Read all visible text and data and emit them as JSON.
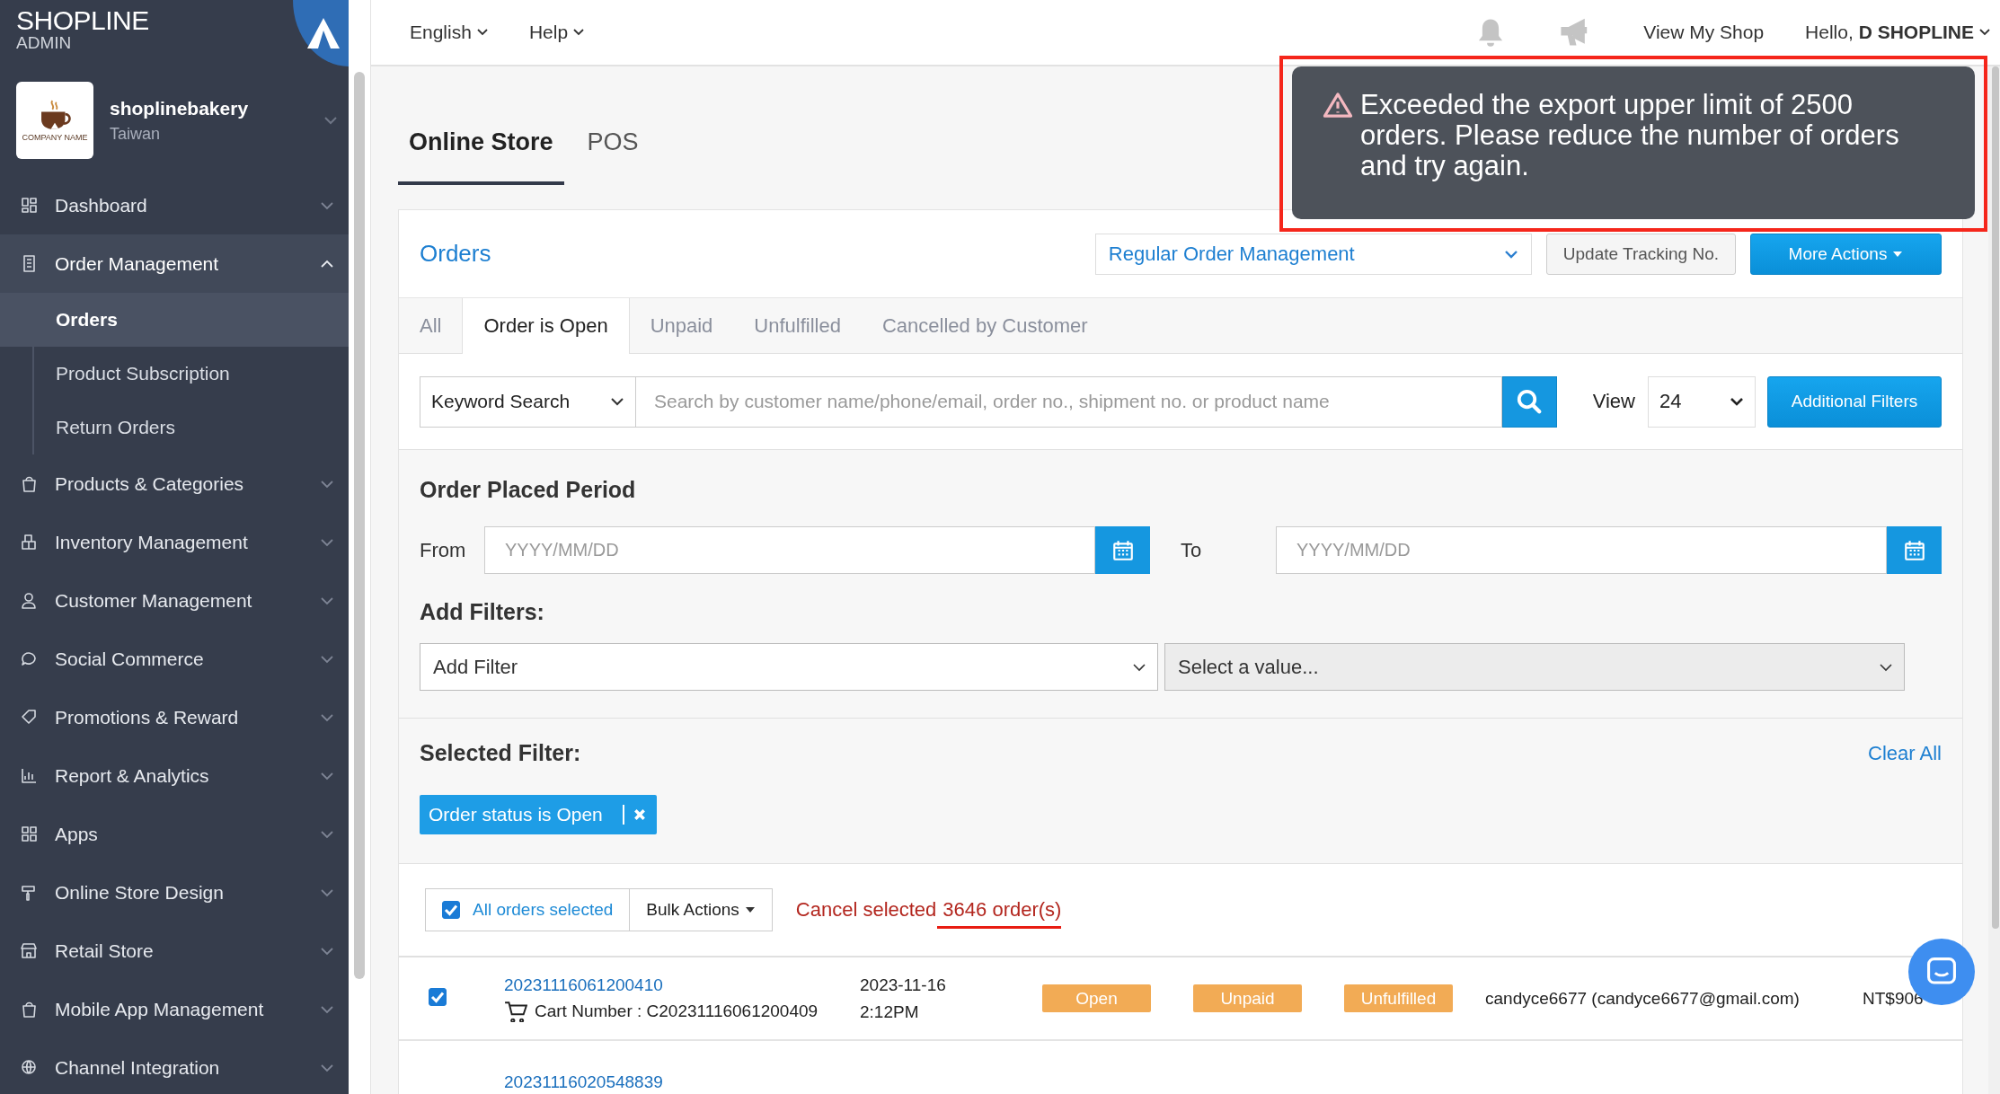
{
  "brand": {
    "logo": "**SHOP**LINE",
    "sub": "ADMIN"
  },
  "store": {
    "name": "shoplinebakery",
    "region": "Taiwan",
    "logo_text": "COMPANY NAME"
  },
  "sidebar": {
    "items": [
      {
        "label": "Dashboard",
        "expanded": false,
        "selected": false
      },
      {
        "label": "Order Management",
        "expanded": true,
        "selected": true,
        "children": [
          {
            "label": "Orders",
            "selected": true
          },
          {
            "label": "Product Subscription",
            "selected": false
          },
          {
            "label": "Return Orders",
            "selected": false
          }
        ]
      },
      {
        "label": "Products & Categories",
        "expanded": false,
        "selected": false
      },
      {
        "label": "Inventory Management",
        "expanded": false,
        "selected": false
      },
      {
        "label": "Customer Management",
        "expanded": false,
        "selected": false
      },
      {
        "label": "Social Commerce",
        "expanded": false,
        "selected": false
      },
      {
        "label": "Promotions & Reward",
        "expanded": false,
        "selected": false
      },
      {
        "label": "Report & Analytics",
        "expanded": false,
        "selected": false
      },
      {
        "label": "Apps",
        "expanded": false,
        "selected": false
      },
      {
        "label": "Online Store Design",
        "expanded": false,
        "selected": false
      },
      {
        "label": "Retail Store",
        "expanded": false,
        "selected": false
      },
      {
        "label": "Mobile App Management",
        "expanded": false,
        "selected": false
      },
      {
        "label": "Channel Integration",
        "expanded": false,
        "selected": false
      }
    ]
  },
  "topbar": {
    "language": "English",
    "help": "Help",
    "view_shop": "View My Shop",
    "greeting": "Hello, **D SHOPLINE**"
  },
  "channel_tabs": [
    {
      "label": "Online Store",
      "selected": true
    },
    {
      "label": "POS",
      "selected": false
    }
  ],
  "toast": {
    "message": "Exceeded the export upper limit of 2500 orders. Please reduce the number of orders and try again."
  },
  "orders_panel": {
    "title": "Orders",
    "mode": "Regular Order Management",
    "buttons": [
      "Update Tracking No.",
      "More Actions"
    ],
    "status_tabs": [
      {
        "label": "All",
        "selected": false
      },
      {
        "label": "Order is Open",
        "selected": true
      },
      {
        "label": "Unpaid",
        "selected": false
      },
      {
        "label": "Unfulfilled",
        "selected": false
      },
      {
        "label": "Cancelled by Customer",
        "selected": false
      }
    ],
    "search": {
      "type": "Keyword Search",
      "placeholder": "Search by customer name/phone/email, order no., shipment no. or product name",
      "view_label": "View",
      "view_value": "24",
      "filters_button": "Additional Filters"
    },
    "period": {
      "title": "Order Placed Period",
      "from_label": "From",
      "from_placeholder": "YYYY/MM/DD",
      "to_label": "To",
      "to_placeholder": "YYYY/MM/DD"
    },
    "add_filters": {
      "title": "Add Filters:",
      "filter": "Add Filter",
      "value": "Select a value..."
    },
    "selected_filter": {
      "title": "Selected Filter:",
      "clear": "Clear All",
      "chips": [
        "Order status is Open"
      ]
    },
    "bulk": {
      "all_selected": {
        "label": "All orders selected",
        "checked": true
      },
      "bulk_actions": "Bulk Actions",
      "cancel_prefix": "Cancel selected",
      "cancel_count": "3646 order(s)"
    },
    "orders": [
      {
        "checked": true,
        "order_no": "20231116061200410",
        "cart": "Cart Number : C20231116061200409",
        "date": "2023-11-16",
        "time": "2:12PM",
        "statuses": [
          "Open",
          "Unpaid",
          "Unfulfilled"
        ],
        "customer": "candyce6677 (candyce6677@gmail.com)",
        "total": "NT$906"
      },
      {
        "order_no": "20231116020548839"
      }
    ]
  }
}
